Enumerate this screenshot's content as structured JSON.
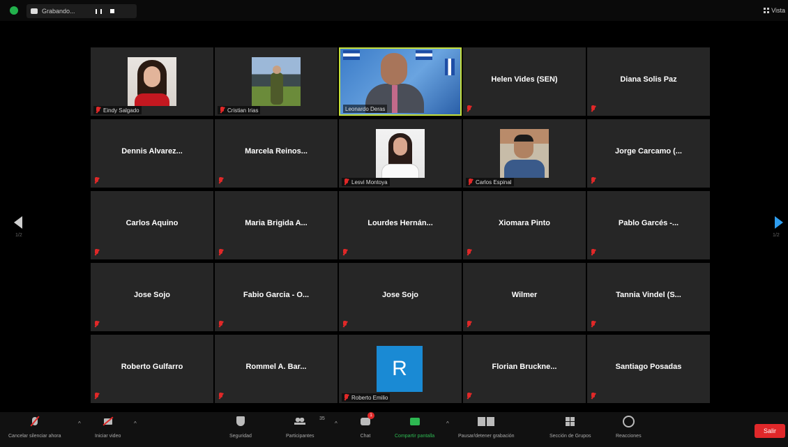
{
  "topbar": {
    "recording_label": "Grabando...",
    "view_label": "Vista"
  },
  "navigation": {
    "page_left": "1/2",
    "page_right": "1/2"
  },
  "participants": [
    {
      "name": "Eindy Salgado",
      "display": "photo",
      "photo_icon": "woman-portrait",
      "muted": true
    },
    {
      "name": "Cristian Irias",
      "display": "photo",
      "photo_icon": "man-outdoor-portrait",
      "muted": true
    },
    {
      "name": "Leonardo Deras",
      "display": "video",
      "active_speaker": true,
      "muted": false
    },
    {
      "name": "Helen Vides (SEN)",
      "display": "name",
      "muted": true
    },
    {
      "name": "Diana Solis Paz",
      "display": "name",
      "muted": true
    },
    {
      "name": "Dennis Alvarez...",
      "display": "name",
      "muted": true
    },
    {
      "name": "Marcela Reinos...",
      "display": "name",
      "muted": true
    },
    {
      "name": "Lesvi Montoya",
      "display": "photo",
      "photo_icon": "woman-portrait",
      "muted": true
    },
    {
      "name": "Carlos Espinal",
      "display": "photo",
      "photo_icon": "man-portrait",
      "muted": true
    },
    {
      "name": "Jorge Carcamo (...",
      "display": "name",
      "muted": true
    },
    {
      "name": "Carlos Aquino",
      "display": "name",
      "muted": true
    },
    {
      "name": "Maria Brigida A...",
      "display": "name",
      "muted": true
    },
    {
      "name": "Lourdes Hernán...",
      "display": "name",
      "muted": true
    },
    {
      "name": "Xiomara Pinto",
      "display": "name",
      "muted": true
    },
    {
      "name": "Pablo Garcés -...",
      "display": "name",
      "muted": true
    },
    {
      "name": "Jose Sojo",
      "display": "name",
      "muted": true
    },
    {
      "name": "Fabio Garcia - O...",
      "display": "name",
      "muted": true
    },
    {
      "name": "Jose Sojo",
      "display": "name",
      "muted": true
    },
    {
      "name": "Wilmer",
      "display": "name",
      "muted": true
    },
    {
      "name": "Tannia Vindel (S...",
      "display": "name",
      "muted": true
    },
    {
      "name": "Roberto Gulfarro",
      "display": "name",
      "muted": true
    },
    {
      "name": "Rommel A. Bar...",
      "display": "name",
      "muted": true
    },
    {
      "name": "Roberto Emilio",
      "display": "avatar",
      "avatar_letter": "R",
      "muted": true
    },
    {
      "name": "Florian Bruckne...",
      "display": "name",
      "muted": true
    },
    {
      "name": "Santiago Posadas",
      "display": "name",
      "muted": true
    }
  ],
  "toolbar": {
    "mute": "Cancelar silenciar ahora",
    "video": "Iniciar video",
    "security": "Seguridad",
    "participants": "Participantes",
    "participants_count": "35",
    "chat": "Chat",
    "chat_badge": "1",
    "share": "Compartir pantalla",
    "record": "Pausar/detener grabación",
    "rooms": "Sección de Grupos",
    "reactions": "Reacciones",
    "leave": "Salir"
  },
  "colors": {
    "active_speaker_border": "#c6e03c",
    "share_green": "#2eb852",
    "leave_red": "#e0282a",
    "next_page_arrow": "#2f9ef0",
    "avatar_blue": "#1a8ad4",
    "muted_red": "#e02828"
  }
}
